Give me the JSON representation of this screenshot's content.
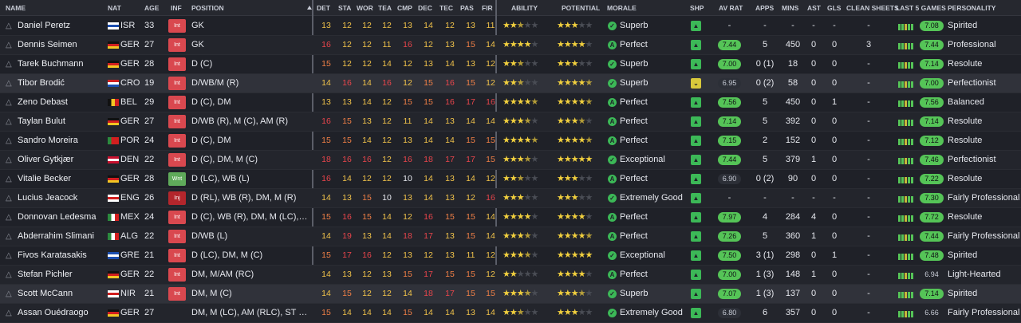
{
  "header": {
    "name": "NAME",
    "nat": "NAT",
    "age": "AGE",
    "inf": "INF",
    "position": "POSITION",
    "det": "DET",
    "sta": "STA",
    "wor": "WOR",
    "tea": "TEA",
    "cmp": "CMP",
    "dec": "DEC",
    "tec": "TEC",
    "pas": "PAS",
    "fir": "FIR",
    "ability": "ABILITY",
    "potential": "POTENTIAL",
    "morale": "MORALE",
    "shp": "SHP",
    "avrat": "AV RAT",
    "apps": "APPS",
    "mins": "MINS",
    "ast": "AST",
    "gls": "GLS",
    "cleansheets": "CLEAN SHEETS",
    "last5": "LAST 5 GAMES",
    "personality": "PERSONALITY"
  },
  "players": [
    {
      "name": "Daniel Peretz",
      "nat": "ISR",
      "age": "33",
      "inf": "Int",
      "pos": "GK",
      "attrs": [
        13,
        12,
        12,
        12,
        13,
        14,
        12,
        13,
        11
      ],
      "ability": 2.5,
      "potential": 3,
      "morale": "Superb",
      "shp": "green",
      "avrat": "-",
      "apps": "-",
      "mins": "-",
      "ast": "-",
      "gls": "-",
      "cs": "-",
      "last5": "7.08",
      "pers": "Spirited"
    },
    {
      "name": "Dennis Seimen",
      "nat": "GER",
      "age": "27",
      "inf": "Int",
      "pos": "GK",
      "attrs": [
        16,
        12,
        12,
        11,
        16,
        12,
        13,
        15,
        14
      ],
      "ability": 4,
      "potential": 4,
      "morale": "Perfect",
      "shp": "green",
      "avrat": "7.44",
      "apps": "5",
      "mins": "450",
      "ast": "0",
      "gls": "0",
      "cs": "3",
      "last5": "7.44",
      "pers": "Professional"
    },
    {
      "name": "Tarek Buchmann",
      "nat": "GER",
      "age": "28",
      "inf": "Int",
      "pos": "D (C)",
      "attrs": [
        15,
        12,
        12,
        14,
        12,
        13,
        14,
        13,
        12
      ],
      "ability": 2.5,
      "potential": 3,
      "morale": "Superb",
      "shp": "green",
      "avrat": "7.00",
      "apps": "0 (1)",
      "mins": "18",
      "ast": "0",
      "gls": "0",
      "cs": "-",
      "last5": "7.14",
      "pers": "Resolute"
    },
    {
      "name": "Tibor Brodić",
      "nat": "CRO",
      "age": "19",
      "inf": "Int",
      "pos": "D/WB/M (R)",
      "attrs": [
        14,
        16,
        14,
        16,
        12,
        15,
        16,
        15,
        12
      ],
      "ability": 2.5,
      "potential": 4.5,
      "morale": "Superb",
      "shp": "yellow",
      "avrat": "6.95",
      "apps": "0 (2)",
      "mins": "58",
      "ast": "0",
      "gls": "0",
      "cs": "-",
      "last5": "7.00",
      "pers": "Perfectionist"
    },
    {
      "name": "Zeno Debast",
      "nat": "BEL",
      "age": "29",
      "inf": "Int",
      "pos": "D (C), DM",
      "attrs": [
        13,
        13,
        14,
        12,
        15,
        15,
        16,
        17,
        16
      ],
      "ability": 4.5,
      "potential": 4.5,
      "morale": "Perfect",
      "shp": "green",
      "avrat": "7.56",
      "apps": "5",
      "mins": "450",
      "ast": "0",
      "gls": "1",
      "cs": "-",
      "last5": "7.56",
      "pers": "Balanced"
    },
    {
      "name": "Taylan Bulut",
      "nat": "GER",
      "age": "27",
      "inf": "Int",
      "pos": "D/WB (R), M (C), AM (R)",
      "attrs": [
        16,
        15,
        13,
        12,
        11,
        14,
        13,
        14,
        14
      ],
      "ability": 3.5,
      "potential": 3.5,
      "morale": "Perfect",
      "shp": "green",
      "avrat": "7.14",
      "apps": "5",
      "mins": "392",
      "ast": "0",
      "gls": "0",
      "cs": "-",
      "last5": "7.14",
      "pers": "Resolute"
    },
    {
      "name": "Sandro Moreira",
      "nat": "POR",
      "age": "24",
      "inf": "Int",
      "pos": "D (C), DM",
      "attrs": [
        15,
        15,
        14,
        12,
        13,
        14,
        14,
        15,
        15
      ],
      "ability": 4.5,
      "potential": 4.5,
      "morale": "Perfect",
      "shp": "green",
      "avrat": "7.15",
      "apps": "2",
      "mins": "152",
      "ast": "0",
      "gls": "0",
      "cs": "-",
      "last5": "7.12",
      "pers": "Resolute"
    },
    {
      "name": "Oliver Gytkjær",
      "nat": "DEN",
      "age": "22",
      "inf": "Int",
      "pos": "D (C), DM, M (C)",
      "attrs": [
        18,
        16,
        16,
        12,
        16,
        18,
        17,
        17,
        15
      ],
      "ability": 3.5,
      "potential": 5,
      "morale": "Exceptional",
      "shp": "green",
      "avrat": "7.44",
      "apps": "5",
      "mins": "379",
      "ast": "1",
      "gls": "0",
      "cs": "-",
      "last5": "7.46",
      "pers": "Perfectionist"
    },
    {
      "name": "Vitalie Becker",
      "nat": "GER",
      "age": "28",
      "inf": "Wnt",
      "pos": "D (LC), WB (L)",
      "attrs": [
        16,
        14,
        12,
        12,
        10,
        14,
        13,
        14,
        12
      ],
      "ability": 2.5,
      "potential": 3,
      "morale": "Perfect",
      "shp": "green",
      "avrat": "6.90",
      "apps": "0 (2)",
      "mins": "90",
      "ast": "0",
      "gls": "0",
      "cs": "-",
      "last5": "7.22",
      "pers": "Resolute"
    },
    {
      "name": "Lucius Jeacock",
      "nat": "ENG",
      "age": "26",
      "inf": "Inj",
      "pos": "D (RL), WB (R), DM, M (R)",
      "attrs": [
        14,
        13,
        15,
        10,
        13,
        14,
        13,
        12,
        16
      ],
      "ability": 3,
      "potential": 3,
      "morale": "Extremely Good",
      "shp": "green",
      "avrat": "-",
      "apps": "-",
      "mins": "-",
      "ast": "-",
      "gls": "-",
      "cs": "-",
      "last5": "7.30",
      "pers": "Fairly Professional"
    },
    {
      "name": "Donnovan Ledesma",
      "nat": "MEX",
      "age": "24",
      "inf": "Int",
      "pos": "D (C), WB (R), DM, M (LC), AM (R)",
      "attrs": [
        15,
        16,
        15,
        14,
        12,
        16,
        15,
        15,
        14
      ],
      "ability": 4,
      "potential": 4,
      "morale": "Perfect",
      "shp": "green",
      "avrat": "7.97",
      "apps": "4",
      "mins": "284",
      "ast": "4",
      "gls": "0",
      "cs": "-",
      "last5": "7.72",
      "pers": "Resolute"
    },
    {
      "name": "Abderrahim Slimani",
      "nat": "ALG",
      "age": "22",
      "inf": "Int",
      "pos": "D/WB (L)",
      "attrs": [
        14,
        19,
        13,
        14,
        18,
        17,
        13,
        15,
        14
      ],
      "ability": 3.5,
      "potential": 4.5,
      "morale": "Perfect",
      "shp": "green",
      "avrat": "7.26",
      "apps": "5",
      "mins": "360",
      "ast": "1",
      "gls": "0",
      "cs": "-",
      "last5": "7.44",
      "pers": "Fairly Professional"
    },
    {
      "name": "Fivos Karatasakis",
      "nat": "GRE",
      "age": "21",
      "inf": "Int",
      "pos": "D (LC), DM, M (C)",
      "attrs": [
        15,
        17,
        16,
        12,
        13,
        12,
        13,
        11,
        12
      ],
      "ability": 3.5,
      "potential": 5,
      "morale": "Exceptional",
      "shp": "green",
      "avrat": "7.50",
      "apps": "3 (1)",
      "mins": "298",
      "ast": "0",
      "gls": "1",
      "cs": "-",
      "last5": "7.48",
      "pers": "Spirited"
    },
    {
      "name": "Stefan Pichler",
      "nat": "GER",
      "age": "22",
      "inf": "Int",
      "pos": "DM, M/AM (RC)",
      "attrs": [
        14,
        13,
        12,
        13,
        15,
        17,
        15,
        15,
        12
      ],
      "ability": 2,
      "potential": 4,
      "morale": "Perfect",
      "shp": "green",
      "avrat": "7.00",
      "apps": "1 (3)",
      "mins": "148",
      "ast": "1",
      "gls": "0",
      "cs": "-",
      "last5": "6.94",
      "pers": "Light-Hearted"
    },
    {
      "name": "Scott McCann",
      "nat": "NIR",
      "age": "21",
      "inf": "Int",
      "pos": "DM, M (C)",
      "attrs": [
        14,
        15,
        12,
        12,
        14,
        18,
        17,
        15,
        15
      ],
      "ability": 3.5,
      "potential": 3.5,
      "morale": "Superb",
      "shp": "green",
      "avrat": "7.07",
      "apps": "1 (3)",
      "mins": "137",
      "ast": "0",
      "gls": "0",
      "cs": "-",
      "last5": "7.14",
      "pers": "Spirited"
    },
    {
      "name": "Assan Ouédraogo",
      "nat": "GER",
      "age": "27",
      "inf": "",
      "pos": "DM, M (LC), AM (RLC), ST (C)",
      "attrs": [
        15,
        14,
        14,
        14,
        15,
        14,
        14,
        13,
        14
      ],
      "ability": 2.5,
      "potential": 3,
      "morale": "Extremely Good",
      "shp": "green",
      "avrat": "6.80",
      "apps": "6",
      "mins": "357",
      "ast": "0",
      "gls": "0",
      "cs": "-",
      "last5": "6.66",
      "pers": "Fairly Professional"
    }
  ]
}
